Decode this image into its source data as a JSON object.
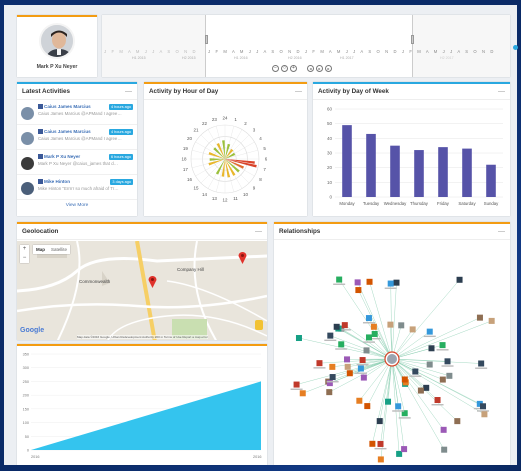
{
  "profile": {
    "name": "Mark P Xu Neyer"
  },
  "timeline": {
    "month_strip_left": "J F M A M J J A S O N D",
    "month_strip": "J F M A M J J A S O N D J F M A M J J A S O N D J F M A M J J A S O N D",
    "halves": [
      "H1 2015",
      "H2 2015",
      "H1 2016",
      "H2 2016",
      "H1 2017",
      "H2 2017"
    ],
    "controls": [
      "zoom-out",
      "zoom-reset",
      "zoom-in",
      "step-back",
      "play",
      "step-forward"
    ]
  },
  "latest_activities": {
    "title": "Latest Activities",
    "items": [
      {
        "name": "Caius James Marcius",
        "message": "Caius James Marcius @APMand I agree…",
        "time": "4 hours ago",
        "source": "twitter-icon"
      },
      {
        "name": "Caius James Marcius",
        "message": "Caius James Marcius @APMand I agree…",
        "time": "4 hours ago",
        "source": "twitter-icon"
      },
      {
        "name": "Mark P Xu Neyer",
        "message": "Mark P Xu Neyer @caius_james that d…",
        "time": "6 hours ago",
        "source": "twitter-icon"
      },
      {
        "name": "Mike Hinton",
        "message": "Mike Hinton \"Errrrr so much afraid of Tr…",
        "time": "3 days ago",
        "source": "facebook-icon"
      }
    ],
    "view_more": "View More"
  },
  "hour_panel": {
    "title": "Activity by Hour of Day",
    "hours": [
      "24",
      "1",
      "2",
      "3",
      "4",
      "5",
      "6",
      "7",
      "8",
      "9",
      "10",
      "11",
      "12",
      "13",
      "14",
      "15",
      "16",
      "17",
      "18",
      "19",
      "20",
      "21",
      "22",
      "23"
    ]
  },
  "week_panel": {
    "title": "Activity by Day of Week"
  },
  "geo_panel": {
    "title": "Geolocation",
    "map_tab": "Map",
    "satellite_tab": "Satellite",
    "places": [
      "Commonwealth",
      "Company Hill"
    ],
    "attribution": "Map data ©2016 Google, Urban Redevelopment Authority  200 m  Terms of Use  Report a map error",
    "logo": "Google"
  },
  "relationships_panel": {
    "title": "Relationships"
  },
  "chart_data": [
    {
      "type": "bar",
      "title": "Activity by Day of Week",
      "categories": [
        "Monday",
        "Tuesday",
        "Wednesday",
        "Thursday",
        "Friday",
        "Saturday",
        "Sunday"
      ],
      "values": [
        49,
        43,
        35,
        32,
        34,
        33,
        22
      ],
      "ylim": [
        0,
        60
      ],
      "yticks": [
        0,
        10,
        20,
        30,
        40,
        50,
        60
      ],
      "color": "#5653a8",
      "grid": true
    },
    {
      "type": "area",
      "x": [
        "2016",
        "2016"
      ],
      "values": [
        0,
        250
      ],
      "ylim": [
        0,
        350
      ],
      "yticks": [
        0,
        50,
        100,
        150,
        200,
        250,
        300,
        350
      ],
      "color": "#34c4ee"
    },
    {
      "type": "radar",
      "title": "Activity by Hour of Day",
      "segments": [
        {
          "angle": 103,
          "len": 0.95,
          "color": "#d9442a"
        },
        {
          "angle": 97,
          "len": 0.88,
          "color": "#d9442a"
        },
        {
          "angle": 115,
          "len": 0.6,
          "color": "#e06b2c"
        },
        {
          "angle": 132,
          "len": 0.55,
          "color": "#9bc03c"
        },
        {
          "angle": 150,
          "len": 0.55,
          "color": "#e9b72c"
        },
        {
          "angle": 168,
          "len": 0.55,
          "color": "#e9b72c"
        },
        {
          "angle": 187,
          "len": 0.52,
          "color": "#e9b72c"
        },
        {
          "angle": 208,
          "len": 0.5,
          "color": "#9bc03c"
        },
        {
          "angle": 252,
          "len": 0.5,
          "color": "#e9b72c"
        },
        {
          "angle": 268,
          "len": 0.45,
          "color": "#9bc03c"
        },
        {
          "angle": 290,
          "len": 0.5,
          "color": "#e9b72c"
        },
        {
          "angle": 315,
          "len": 0.45,
          "color": "#9bc03c"
        },
        {
          "angle": 335,
          "len": 0.5,
          "color": "#e9b72c"
        },
        {
          "angle": 355,
          "len": 0.55,
          "color": "#9bc03c"
        },
        {
          "angle": 15,
          "len": 0.45,
          "color": "#9bc03c"
        },
        {
          "angle": 38,
          "len": 0.35,
          "color": "#e9b72c"
        },
        {
          "angle": 62,
          "len": 0.32,
          "color": "#9bc03c"
        }
      ]
    }
  ]
}
